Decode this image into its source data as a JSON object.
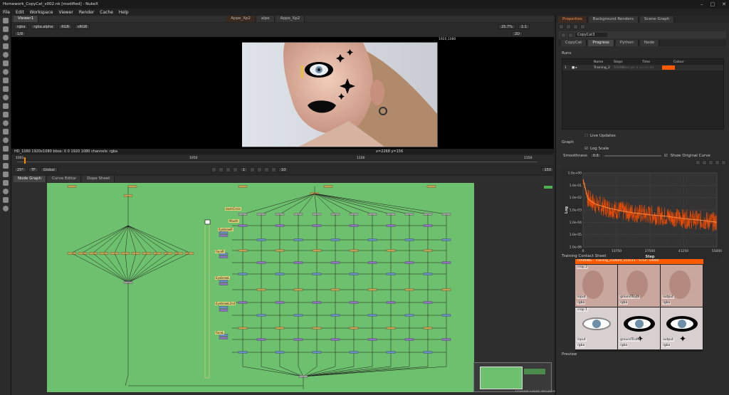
{
  "window": {
    "title": "Homework_CopyCat_v002.nk [modified] - NukeX"
  },
  "menu": [
    "File",
    "Edit",
    "Workspace",
    "Viewer",
    "Render",
    "Cache",
    "Help"
  ],
  "viewer_tabs": {
    "viewer": "Viewer1",
    "node_a": "Appe_Xp2",
    "node_b": "alpe",
    "node_c": "Appe_Xp2"
  },
  "viewer_controls": {
    "channels": "rgba",
    "alpha": "rgba.alpha",
    "color": "RGB",
    "lut": "sRGB",
    "frame": "1/8",
    "zoom": "25.7%",
    "ratio": "1:1",
    "mode": "2D",
    "res_tag": "1920,1080"
  },
  "viewer_status": {
    "info": "HD_1080 1920x1080  bbox: 0 0 1920 1080 channels: rgba",
    "coords": "x=2268 y=156"
  },
  "timeline": {
    "start": "1001",
    "mid1": "1050",
    "mid2": "1100",
    "end": "1150",
    "end_right": "1150",
    "fps": "25*",
    "tf": "TF",
    "global": "Global",
    "current": "1",
    "step": "10",
    "range_end": "150"
  },
  "nodegraph_tabs": [
    "Node Graph",
    "Curve Editor",
    "Dope Sheet"
  ],
  "nodes": {
    "n1": "dashCircle",
    "n2": "Mouth",
    "n3": "EyebrowR",
    "n4": "FaceR",
    "n5": "EyebrowL",
    "n6": "EyebrowL2nd",
    "n7": "FaceL"
  },
  "status_bar": "Channel Count: 40  Localization Mode: On  Memory: 1.3 GB (6.0%)  CPU: 2.1%  Disk: 0.2 MB/s  Network: 0.0 MB/s",
  "props": {
    "tabs": [
      "Properties",
      "Background Renders",
      "Scene Graph"
    ],
    "node_name": "CopyCat3",
    "node_tabs": [
      "CopyCat",
      "Progress",
      "Python",
      "Node"
    ],
    "runs_label": "Runs",
    "run_cols": [
      "Name",
      "Steps",
      "Time",
      "Colour"
    ],
    "run_row": {
      "idx": "1",
      "name": "Training_2",
      "steps": "55000",
      "time": "Wed Jun  4 15:37:05"
    },
    "live_updates": "Live Updates",
    "graph_label": "Graph",
    "log_scale": "Log Scale",
    "smoothness_label": "Smoothness",
    "smoothness_value": "0.6",
    "show_original": "Show Original Curve",
    "chart_title_y": "Log",
    "chart_title_x": "Step",
    "contact_label": "Training Contact Sheet",
    "training_banner": "TRAINING - Training_250604_115511 - STEP: 54900",
    "crop2": "crop 2",
    "crop1": "crop 1",
    "input": "input",
    "rgba": "rgba",
    "ground": "groundTruth",
    "output": "output",
    "preview": "Preview"
  },
  "chart_data": {
    "type": "line",
    "xlabel": "Step",
    "ylabel": "Log",
    "log_y": true,
    "x_ticks": [
      "0",
      "13750",
      "27500",
      "41250",
      "55000"
    ],
    "y_ticks": [
      "1.0e+00",
      "1.0e-01",
      "1.0e-02",
      "1.0e-03",
      "1.0e-04",
      "1.0e-05",
      "1.0e-06"
    ],
    "xlim": [
      0,
      55000
    ],
    "ylim": [
      1e-06,
      1
    ],
    "series": [
      {
        "color": "#ff4d00",
        "x": [
          0,
          2000,
          5000,
          10000,
          15000,
          20000,
          27500,
          35000,
          41250,
          48000,
          55000
        ],
        "y": [
          0.3,
          0.008,
          0.003,
          0.0015,
          0.0009,
          0.0006,
          0.0004,
          0.0003,
          0.0002,
          0.00015,
          0.0001
        ]
      }
    ]
  },
  "colors": {
    "accent": "#ff5a00",
    "canvas": "#6dc06d"
  }
}
